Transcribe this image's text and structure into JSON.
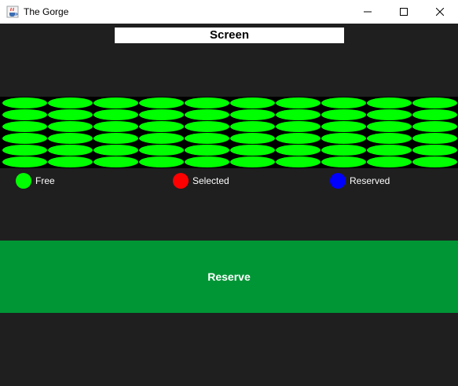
{
  "window": {
    "title": "The Gorge",
    "icon": "java-cup-icon",
    "controls": [
      "minimize",
      "maximize",
      "close"
    ]
  },
  "screen": {
    "label": "Screen"
  },
  "seating": {
    "rows": 6,
    "columns": 10,
    "seat_state": "free"
  },
  "legend": {
    "free": {
      "label": "Free",
      "color": "#00ff00"
    },
    "selected": {
      "label": "Selected",
      "color": "#ff0000"
    },
    "reserved": {
      "label": "Reserved",
      "color": "#0000ff"
    }
  },
  "actions": {
    "reserve_label": "Reserve"
  },
  "colors": {
    "background": "#1f1f1f",
    "grid_background": "#000000",
    "reserve_button": "#009636"
  }
}
